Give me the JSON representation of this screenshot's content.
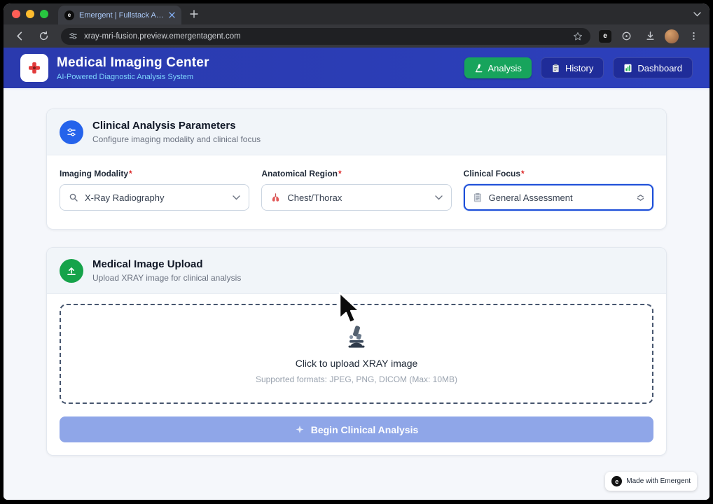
{
  "browser": {
    "tab_title": "Emergent | Fullstack App",
    "tab_favicon_glyph": "e",
    "url": "xray-mri-fusion.preview.emergentagent.com",
    "ext_badge_glyph": "e"
  },
  "header": {
    "title": "Medical Imaging Center",
    "subtitle": "AI-Powered Diagnostic Analysis System",
    "nav": [
      {
        "label": "Analysis",
        "icon": "microscope-icon",
        "active": true
      },
      {
        "label": "History",
        "icon": "history-clipboard-icon",
        "active": false
      },
      {
        "label": "Dashboard",
        "icon": "bar-chart-icon",
        "active": false
      }
    ]
  },
  "parameters_card": {
    "title": "Clinical Analysis Parameters",
    "subtitle": "Configure imaging modality and clinical focus",
    "fields": [
      {
        "label": "Imaging Modality",
        "required_mark": "*",
        "value": "X-Ray Radiography",
        "icon": "magnifier-icon",
        "focused": false
      },
      {
        "label": "Anatomical Region",
        "required_mark": "*",
        "value": "Chest/Thorax",
        "icon": "lungs-icon",
        "focused": false
      },
      {
        "label": "Clinical Focus",
        "required_mark": "*",
        "value": "General Assessment",
        "icon": "clipboard-icon",
        "focused": true
      }
    ]
  },
  "upload_card": {
    "title": "Medical Image Upload",
    "subtitle": "Upload XRAY image for clinical analysis",
    "dropzone": {
      "icon": "microscope-icon",
      "title": "Click to upload XRAY image",
      "hint": "Supported formats: JPEG, PNG, DICOM (Max: 10MB)"
    },
    "submit": {
      "label": "Begin Clinical Analysis",
      "icon": "sparkle-icon"
    }
  },
  "footer_badge": {
    "label": "Made with Emergent",
    "glyph": "e"
  },
  "colors": {
    "header_blue": "#2B3EB3",
    "analysis_green": "#17A45C",
    "primary_blue": "#2563EB",
    "success_green": "#16A34A",
    "focus_ring": "#1D4ED8",
    "submit_disabled": "#8FA6E8",
    "required_red": "#DC2626"
  }
}
